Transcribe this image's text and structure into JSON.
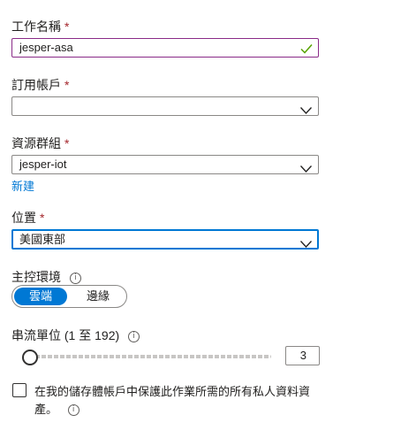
{
  "job_name": {
    "label": "工作名稱",
    "required_mark": "*",
    "value": "jesper-asa"
  },
  "subscription": {
    "label": "訂用帳戶",
    "required_mark": "*",
    "value": ""
  },
  "resource_group": {
    "label": "資源群組",
    "required_mark": "*",
    "value": "jesper-iot",
    "create_new_link": "新建"
  },
  "location": {
    "label": "位置",
    "required_mark": "*",
    "value": "美國東部"
  },
  "hosting_environment": {
    "label": "主控環境",
    "info_glyph": "i",
    "options": [
      "雲端",
      "邊緣"
    ],
    "selected": "雲端"
  },
  "streaming_units": {
    "label": "串流單位 (1 至 192)",
    "info_glyph": "i",
    "value": "3"
  },
  "secure_assets": {
    "text": "在我的儲存體帳戶中保護此作業所需的所有私人資料資產。",
    "checked": false,
    "info_glyph": "i"
  },
  "colors": {
    "accent": "#0078d4",
    "required": "#a4262c",
    "valid_check": "#57a300",
    "valid_border": "#8a2b88"
  },
  "icons": [
    "checkmark-icon",
    "chevron-down-icon",
    "info-icon"
  ]
}
